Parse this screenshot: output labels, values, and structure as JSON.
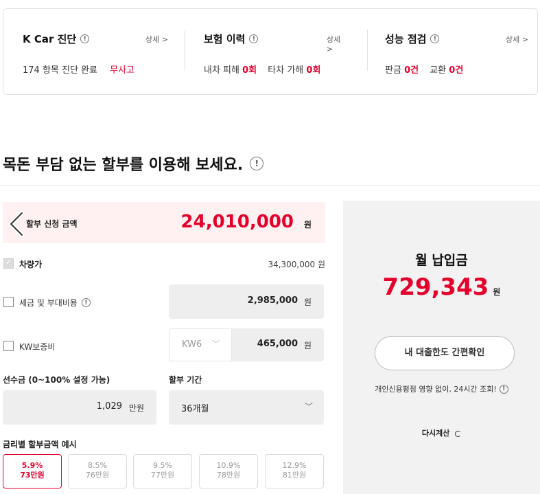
{
  "summary": {
    "diag": {
      "title": "K Car 진단",
      "more": "상세 >",
      "count_text": "174 항목 진단 완료",
      "status": "무사고"
    },
    "insurance": {
      "title": "보험 이력",
      "more": "상세 >",
      "own_label": "내차 피해",
      "own_value": "0회",
      "other_label": "타차 가해",
      "other_value": "0회"
    },
    "inspection": {
      "title": "성능 점검",
      "more": "상세 >",
      "panel_label": "판금",
      "panel_value": "0건",
      "replace_label": "교환",
      "replace_value": "0건"
    }
  },
  "section": {
    "title": "목돈 부담 없는 할부를 이용해 보세요."
  },
  "form": {
    "apply_label": "할부 신청 금액",
    "apply_amount": "24,010,000",
    "apply_unit": "원",
    "car_price_label": "차량가",
    "car_price": "34,300,000 원",
    "tax_label": "세금 및 부대비용",
    "tax_value": "2,985,000",
    "tax_unit": "원",
    "warranty_label": "KW보증비",
    "warranty_option": "KW6",
    "warranty_value": "465,000",
    "warranty_unit": "원",
    "down_title": "선수금 (0~100% 설정 가능)",
    "down_value": "1,029",
    "down_unit": "만원",
    "period_title": "할부 기간",
    "period_value": "36개월",
    "rate_title": "금리별 할부금액 예시",
    "rates": [
      {
        "rate": "5.9%",
        "amount": "73만원"
      },
      {
        "rate": "8.5%",
        "amount": "76만원"
      },
      {
        "rate": "9.5%",
        "amount": "77만원"
      },
      {
        "rate": "10.9%",
        "amount": "78만원"
      },
      {
        "rate": "12.9%",
        "amount": "81만원"
      }
    ]
  },
  "result": {
    "title": "월 납입금",
    "amount": "729,343",
    "unit": "원",
    "check_button": "내 대출한도 간편확인",
    "note": "개인신용평점 영향 없이, 24시간 조회!",
    "recalc": "다시계산"
  },
  "colors": {
    "accent": "#e4002b",
    "panel_bg": "#f2f2f2",
    "apply_bg": "#fff1f1"
  }
}
